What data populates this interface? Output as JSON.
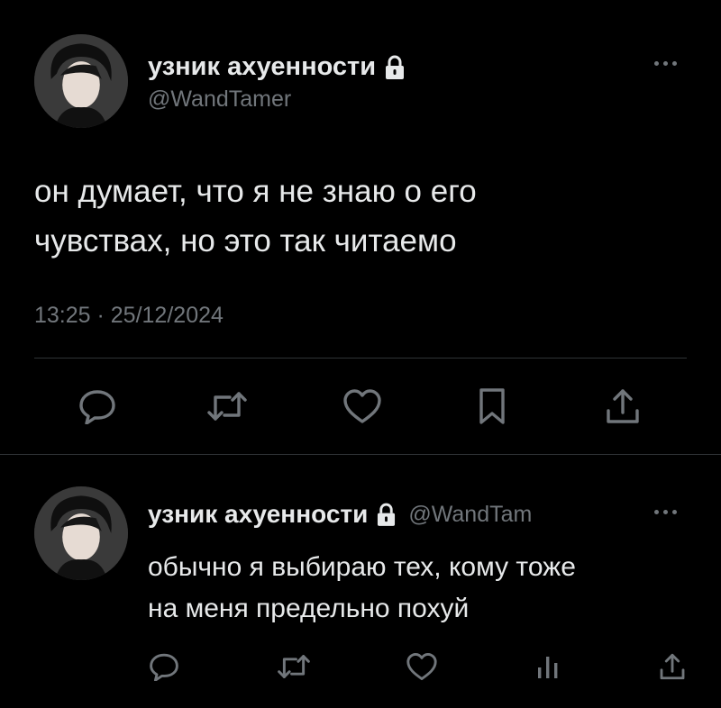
{
  "main_tweet": {
    "display_name": "узник ахуенности",
    "handle": "@WandTamer",
    "text_line1": "он думает, что я не знаю о его",
    "text_line2": "чувствах, но это так читаемо",
    "timestamp": "13:25 · 25/12/2024",
    "actions": [
      "reply-icon",
      "retweet-icon",
      "like-icon",
      "bookmark-icon",
      "share-icon"
    ]
  },
  "reply_tweet": {
    "display_name": "узник ахуенности",
    "handle": "@WandTam",
    "text_line1": "обычно я выбираю тех, кому тоже",
    "text_line2": "на меня предельно похуй",
    "actions": [
      "reply-icon",
      "retweet-icon",
      "like-icon",
      "views-icon",
      "share-icon"
    ]
  },
  "colors": {
    "background": "#000000",
    "text": "#e7e9ea",
    "muted": "#71767b",
    "divider": "#2f3336"
  }
}
